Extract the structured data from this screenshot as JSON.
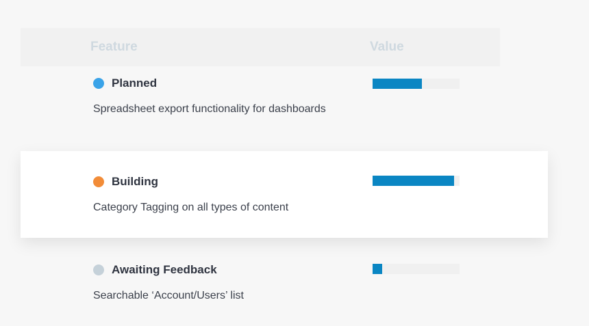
{
  "table": {
    "header": {
      "feature": "Feature",
      "value": "Value"
    },
    "rows": [
      {
        "status": "Planned",
        "description": "Spreadsheet export functionality for dashboards",
        "status_color": "#3aa3e8",
        "progress_fraction": 0.57
      },
      {
        "status": "Building",
        "description": "Category Tagging on all types of content",
        "status_color": "#f28c38",
        "progress_fraction": 0.94
      },
      {
        "status": "Awaiting Feedback",
        "description": "Searchable ‘Account/Users’ list",
        "status_color": "#c5d1d9",
        "progress_fraction": 0.11
      }
    ],
    "bar_color": "#0a86c3",
    "track_color": "#f0f0f0"
  }
}
